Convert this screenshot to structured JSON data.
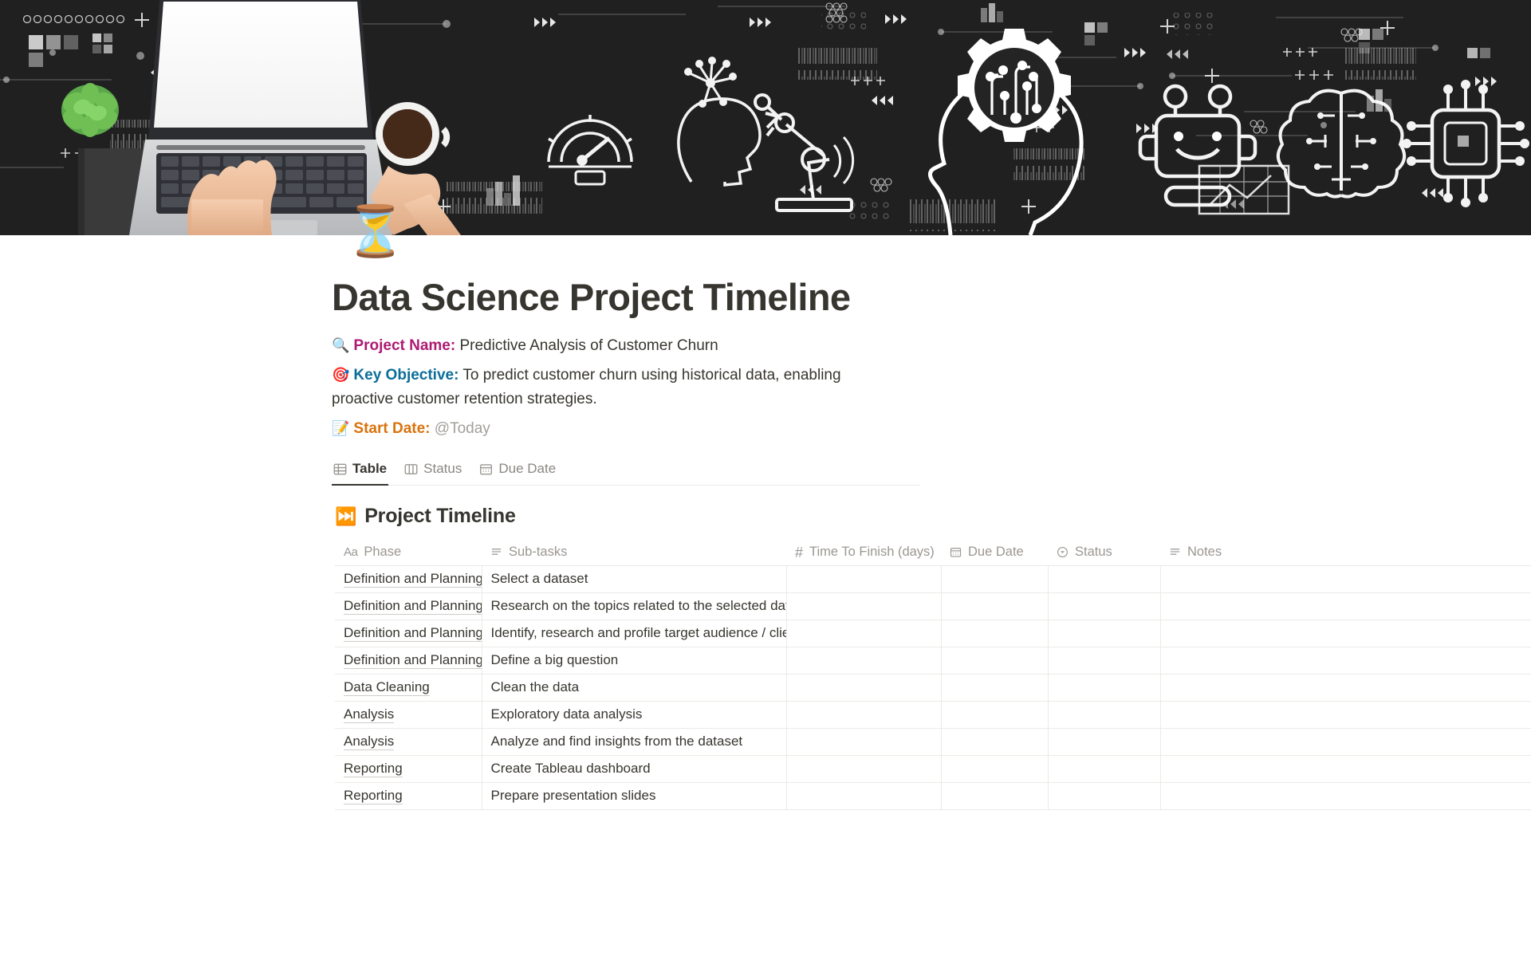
{
  "cover": {
    "alt": "dark technology banner with laptop, hands typing, succulent plant, coffee cup and white line-art AI icons",
    "background_color": "#1c1c1c",
    "line_art_color": "#ffffff"
  },
  "page": {
    "icon": "⏳",
    "title": "Data Science Project Timeline"
  },
  "properties": [
    {
      "icon": "🔍",
      "label": "Project Name:",
      "label_color": "#ad1a72",
      "value": "Predictive Analysis of Customer Churn"
    },
    {
      "icon": "🎯",
      "label": "Key Objective:",
      "label_color": "#0b6e99",
      "value": "To predict customer churn using historical data, enabling proactive customer retention strategies."
    },
    {
      "icon": "📝",
      "label": "Start Date:",
      "label_color": "#d9730d",
      "value": "@Today"
    }
  ],
  "tabs": [
    {
      "label": "Table",
      "icon": "table-icon",
      "active": true
    },
    {
      "label": "Status",
      "icon": "board-icon",
      "active": false
    },
    {
      "label": "Due Date",
      "icon": "calendar-icon",
      "active": false
    }
  ],
  "database": {
    "icon": "⏭️",
    "title": "Project Timeline",
    "columns": [
      {
        "label": "Phase",
        "icon": "title-text-icon"
      },
      {
        "label": "Sub-tasks",
        "icon": "text-icon"
      },
      {
        "label": "Time To Finish (days)",
        "icon": "number-icon"
      },
      {
        "label": "Due Date",
        "icon": "calendar-icon"
      },
      {
        "label": "Status",
        "icon": "select-icon"
      },
      {
        "label": "Notes",
        "icon": "text-icon"
      }
    ],
    "rows": [
      {
        "phase": "Definition and Planning",
        "subtask": "Select a dataset",
        "time": "",
        "due": "",
        "status": "",
        "notes": ""
      },
      {
        "phase": "Definition and Planning",
        "subtask": "Research on the topics related to the selected dataset",
        "time": "",
        "due": "",
        "status": "",
        "notes": ""
      },
      {
        "phase": "Definition and Planning",
        "subtask": "Identify, research and profile target audience / client",
        "time": "",
        "due": "",
        "status": "",
        "notes": ""
      },
      {
        "phase": "Definition and Planning",
        "subtask": "Define a big question",
        "time": "",
        "due": "",
        "status": "",
        "notes": ""
      },
      {
        "phase": "Data Cleaning",
        "subtask": "Clean the data",
        "time": "",
        "due": "",
        "status": "",
        "notes": ""
      },
      {
        "phase": "Analysis",
        "subtask": "Exploratory data analysis",
        "time": "",
        "due": "",
        "status": "",
        "notes": ""
      },
      {
        "phase": "Analysis",
        "subtask": "Analyze and find insights from the dataset",
        "time": "",
        "due": "",
        "status": "",
        "notes": ""
      },
      {
        "phase": "Reporting",
        "subtask": "Create Tableau dashboard",
        "time": "",
        "due": "",
        "status": "",
        "notes": ""
      },
      {
        "phase": "Reporting",
        "subtask": "Prepare presentation slides",
        "time": "",
        "due": "",
        "status": "",
        "notes": ""
      }
    ]
  },
  "colors": {
    "text": "#37352f",
    "muted": "#9b9792",
    "border": "#eceae6",
    "mention": "#a3a09a"
  }
}
